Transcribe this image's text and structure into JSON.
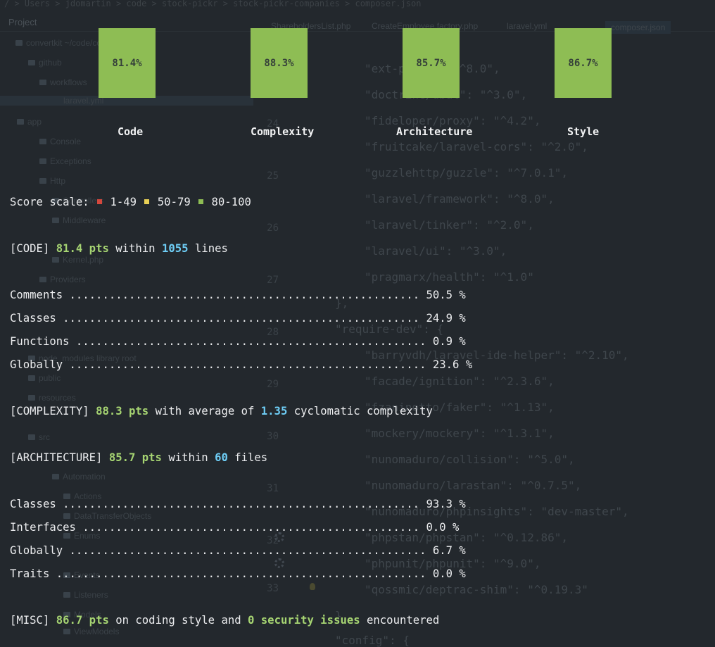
{
  "ide": {
    "breadcrumb": "/ > Users > jdomartin > code > stock-pickr > stock-pickr-companies > composer.json",
    "project_title": "Project",
    "tabs": [
      "ShareholdersList.php",
      "CreateEmployee.factory.php",
      "laravel.yml",
      "composer.json"
    ],
    "tree": [
      "convertkit ~/code/convertkit",
      "github",
      "workflows",
      "laravel.yml",
      "app",
      "Console",
      "Exceptions",
      "Http",
      "Controllers",
      "Middleware",
      "Kernel.php",
      "Providers",
      "node_modules library root",
      "public",
      "resources",
      "src",
      "Automation",
      "Actions",
      "DataTransferObjects",
      "Enums",
      "Events",
      "Listeners",
      "Models",
      "ViewModels"
    ],
    "line_numbers": [
      "23",
      "24",
      "25",
      "26",
      "27",
      "28",
      "29",
      "30",
      "31",
      "32",
      "33"
    ],
    "code_lines": [
      "\"ext-posix\": \"^8.0\",",
      "\"doctrine/dbal\": \"^3.0\",",
      "\"fideloper/proxy\": \"^4.2\",",
      "\"fruitcake/laravel-cors\": \"^2.0\",",
      "\"guzzlehttp/guzzle\": \"^7.0.1\",",
      "\"laravel/framework\": \"^8.0\",",
      "\"laravel/tinker\": \"^2.0\",",
      "\"laravel/ui\": \"^3.0\",",
      "\"pragmarx/health\": \"^1.0\"",
      "},",
      "\"require-dev\": {",
      "\"barryvdh/laravel-ide-helper\": \"^2.10\",",
      "\"facade/ignition\": \"^2.3.6\",",
      "\"fzaninotto/faker\": \"^1.13\",",
      "\"mockery/mockery\": \"^1.3.1\",",
      "\"nunomaduro/collision\": \"^5.0\",",
      "\"nunomaduro/larastan\": \"^0.7.5\",",
      "\"nunomaduro/phpinsights\": \"dev-master\",",
      "\"phpstan/phpstan\": \"^0.12.86\",",
      "\"phpunit/phpunit\": \"^9.0\",",
      "\"qossmic/deptrac-shim\": \"^0.19.3\"",
      "},",
      "\"config\": {"
    ]
  },
  "summary": {
    "boxes": [
      {
        "value": "81.4%",
        "label": "Code"
      },
      {
        "value": "88.3%",
        "label": "Complexity"
      },
      {
        "value": "85.7%",
        "label": "Architecture"
      },
      {
        "value": "86.7%",
        "label": "Style"
      }
    ],
    "box_color": "#8ebd54"
  },
  "score_scale": {
    "label": "Score scale:",
    "ranges": [
      "1-49",
      "50-79",
      "80-100"
    ],
    "colors": [
      "#d5483d",
      "#e8cf55",
      "#8ebd54"
    ]
  },
  "code_section": {
    "tag": "[CODE]",
    "score": "81.4 pts",
    "mid": "within",
    "count": "1055",
    "tail": "lines",
    "metrics": [
      {
        "name": "Comments",
        "value": "50.5 %"
      },
      {
        "name": "Classes",
        "value": "24.9 %"
      },
      {
        "name": "Functions",
        "value": "0.9 %"
      },
      {
        "name": "Globally",
        "value": "23.6 %"
      }
    ]
  },
  "complexity_section": {
    "tag": "[COMPLEXITY]",
    "score": "88.3 pts",
    "mid": "with average of",
    "value": "1.35",
    "tail": "cyclomatic complexity"
  },
  "architecture_section": {
    "tag": "[ARCHITECTURE]",
    "score": "85.7 pts",
    "mid": "within",
    "count": "60",
    "tail": "files",
    "metrics": [
      {
        "name": "Classes",
        "value": "93.3 %"
      },
      {
        "name": "Interfaces",
        "value": "0.0 %"
      },
      {
        "name": "Globally",
        "value": "6.7 %"
      },
      {
        "name": "Traits",
        "value": "0.0 %"
      }
    ]
  },
  "misc_section": {
    "tag": "[MISC]",
    "score": "86.7 pts",
    "mid": "on coding style and",
    "issues": "0 security issues",
    "tail": "encountered"
  }
}
